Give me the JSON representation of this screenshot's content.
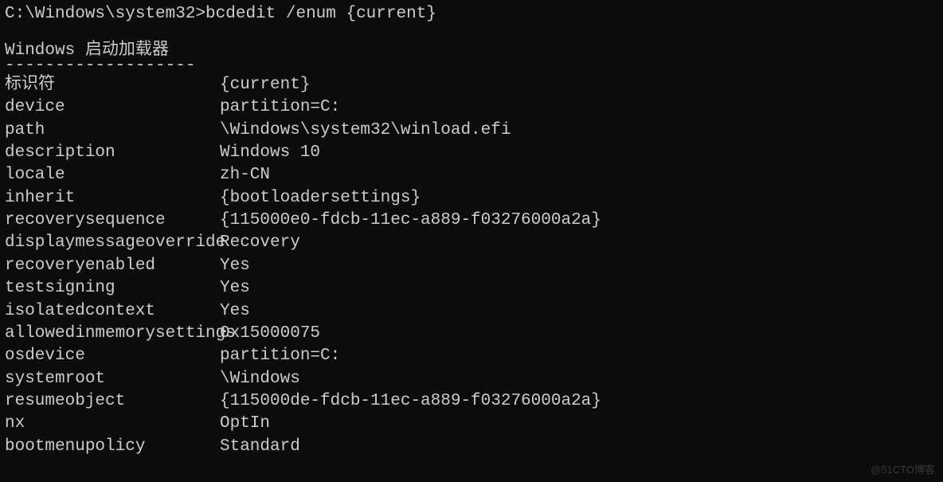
{
  "prompt": {
    "prefix": "C:\\Windows\\system32>",
    "command": "bcdedit /enum {current}"
  },
  "section_title": "Windows 启动加载器",
  "underline": "-------------------",
  "entries": [
    {
      "key": "标识符",
      "value": "{current}"
    },
    {
      "key": "device",
      "value": "partition=C:"
    },
    {
      "key": "path",
      "value": "\\Windows\\system32\\winload.efi"
    },
    {
      "key": "description",
      "value": "Windows 10"
    },
    {
      "key": "locale",
      "value": "zh-CN"
    },
    {
      "key": "inherit",
      "value": "{bootloadersettings}"
    },
    {
      "key": "recoverysequence",
      "value": "{115000e0-fdcb-11ec-a889-f03276000a2a}"
    },
    {
      "key": "displaymessageoverride",
      "value": "Recovery"
    },
    {
      "key": "recoveryenabled",
      "value": "Yes"
    },
    {
      "key": "testsigning",
      "value": "Yes"
    },
    {
      "key": "isolatedcontext",
      "value": "Yes"
    },
    {
      "key": "allowedinmemorysettings",
      "value": "0x15000075"
    },
    {
      "key": "osdevice",
      "value": "partition=C:"
    },
    {
      "key": "systemroot",
      "value": "\\Windows"
    },
    {
      "key": "resumeobject",
      "value": "{115000de-fdcb-11ec-a889-f03276000a2a}"
    },
    {
      "key": "nx",
      "value": "OptIn"
    },
    {
      "key": "bootmenupolicy",
      "value": "Standard"
    }
  ],
  "watermark": "@51CTO博客"
}
